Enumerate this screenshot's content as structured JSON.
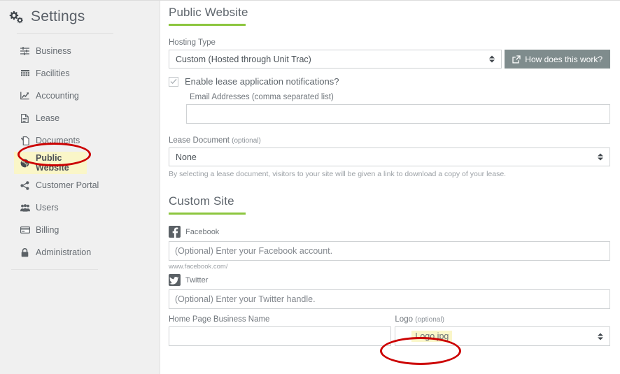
{
  "sidebar": {
    "title": "Settings",
    "title_icon": "cogs-icon",
    "items": [
      {
        "label": "Business",
        "icon": "sliders-icon",
        "active": false
      },
      {
        "label": "Facilities",
        "icon": "grid-icon",
        "active": false
      },
      {
        "label": "Accounting",
        "icon": "line-chart-icon",
        "active": false
      },
      {
        "label": "Lease",
        "icon": "file-icon",
        "active": false
      },
      {
        "label": "Documents",
        "icon": "copy-files-icon",
        "active": false
      },
      {
        "label": "Public Website",
        "icon": "globe-icon",
        "active": true
      },
      {
        "label": "Customer Portal",
        "icon": "share-icon",
        "active": false
      },
      {
        "label": "Users",
        "icon": "users-icon",
        "active": false
      },
      {
        "label": "Billing",
        "icon": "credit-card-icon",
        "active": false
      },
      {
        "label": "Administration",
        "icon": "lock-icon",
        "active": false
      }
    ]
  },
  "main": {
    "section_public_website": {
      "title": "Public Website",
      "hosting_type": {
        "label": "Hosting Type",
        "value": "Custom (Hosted through Unit Trac)"
      },
      "how_button": {
        "label": "How does this work?",
        "icon": "external-link-icon"
      },
      "notifications_checkbox": {
        "label": "Enable lease application notifications?",
        "checked": true
      },
      "email_addresses": {
        "label": "Email Addresses (comma separated list)",
        "value": "",
        "placeholder": ""
      },
      "lease_document": {
        "label": "Lease Document",
        "label_optional": "(optional)",
        "value": "None",
        "help": "By selecting a lease document, visitors to your site will be given a link to download a copy of your lease."
      }
    },
    "section_custom_site": {
      "title": "Custom Site",
      "facebook": {
        "label": "Facebook",
        "icon": "facebook-icon",
        "value": "",
        "placeholder": "(Optional) Enter your Facebook account.",
        "prefix_help": "www.facebook.com/"
      },
      "twitter": {
        "label": "Twitter",
        "icon": "twitter-icon",
        "value": "",
        "placeholder": "(Optional) Enter your Twitter handle."
      },
      "home_page_business_name": {
        "label": "Home Page Business Name",
        "value": "",
        "placeholder": ""
      },
      "logo": {
        "label": "Logo",
        "label_optional": "(optional)",
        "value": "Logo.jpg"
      }
    }
  },
  "annotations": {
    "highlight_color": "#faf6c8",
    "ellipse_color": "#cc0000",
    "accent_color": "#8cc63f",
    "button_color": "#7f8c8d"
  }
}
